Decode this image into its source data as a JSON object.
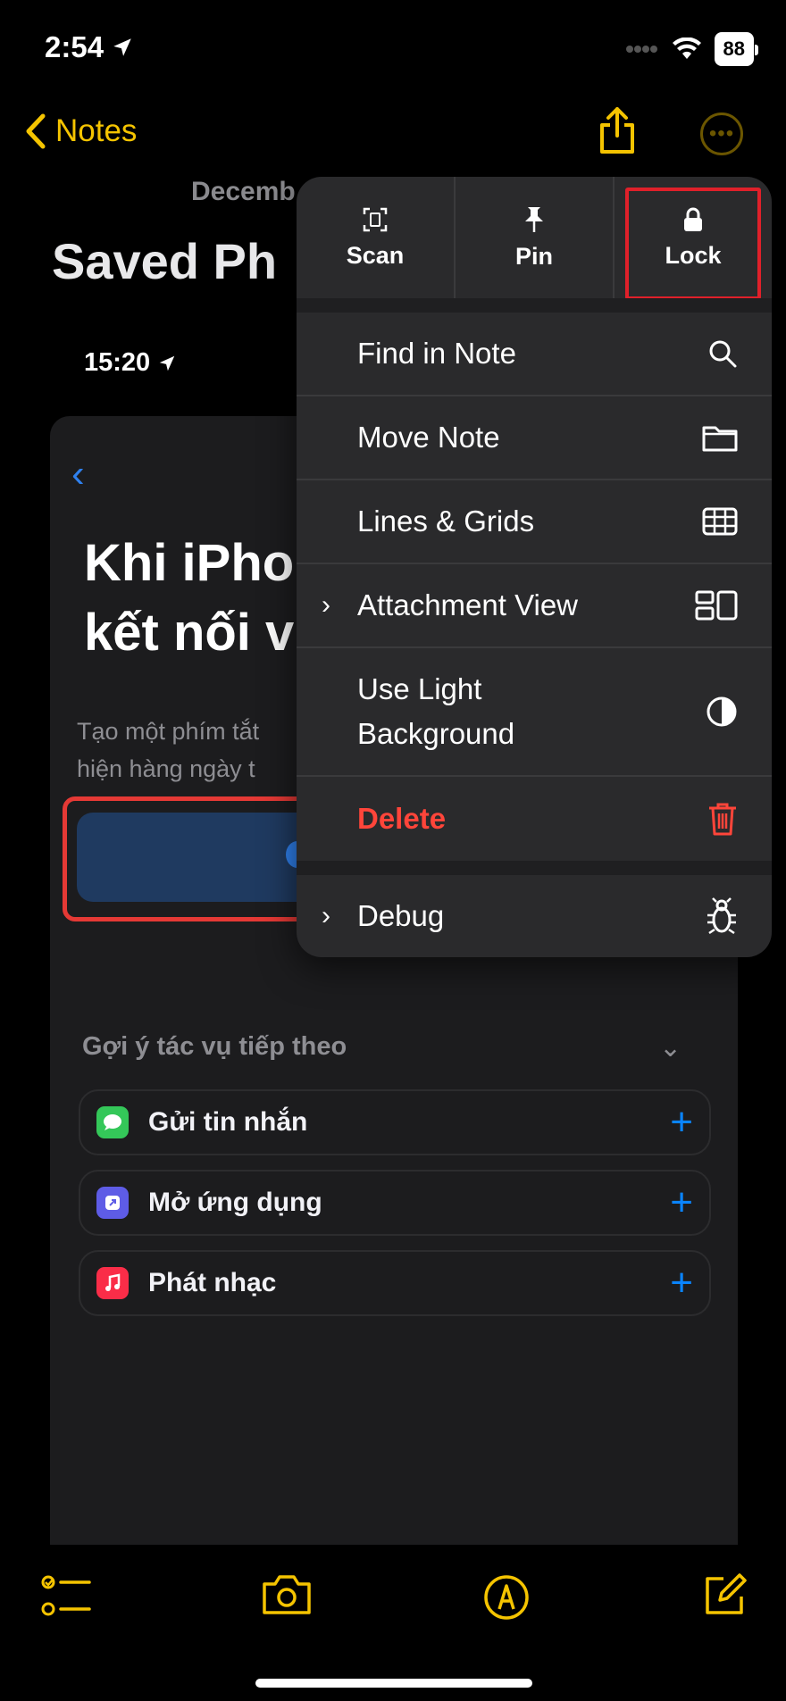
{
  "status_bar": {
    "time": "2:54",
    "battery": "88"
  },
  "nav": {
    "back_label": "Notes"
  },
  "note": {
    "date": "Decemb",
    "title": "Saved Ph"
  },
  "embedded_screenshot": {
    "time": "15:20",
    "heading": "Khi iPho\nkết nối v",
    "description": "Tạo một phím tắt\nhiện hàng ngày t",
    "suggestions_header": "Gợi ý tác vụ tiếp theo",
    "suggestions": [
      {
        "label": "Gửi tin nhắn",
        "icon": "messages-icon",
        "color": "#34c759"
      },
      {
        "label": "Mở ứng dụng",
        "icon": "open-app-icon",
        "color": "#5e5ce6"
      },
      {
        "label": "Phát nhạc",
        "icon": "music-icon",
        "color": "#fa2d48"
      }
    ]
  },
  "menu": {
    "top_actions": [
      {
        "label": "Scan",
        "icon": "scan-icon"
      },
      {
        "label": "Pin",
        "icon": "pin-icon"
      },
      {
        "label": "Lock",
        "icon": "lock-icon"
      }
    ],
    "items": [
      {
        "label": "Find in Note",
        "icon": "magnifier-icon"
      },
      {
        "label": "Move Note",
        "icon": "folder-icon"
      },
      {
        "label": "Lines & Grids",
        "icon": "grid-icon"
      },
      {
        "label": "Attachment View",
        "icon": "attachment-view-icon"
      },
      {
        "label": "Use Light\nBackground",
        "icon": "contrast-icon"
      },
      {
        "label": "Delete",
        "icon": "trash-icon"
      },
      {
        "label": "Debug",
        "icon": "bug-icon"
      }
    ]
  },
  "colors": {
    "accent": "#f5c400",
    "destructive": "#ff453a",
    "highlight_frame": "#e0202a",
    "link_blue": "#0a84ff"
  }
}
